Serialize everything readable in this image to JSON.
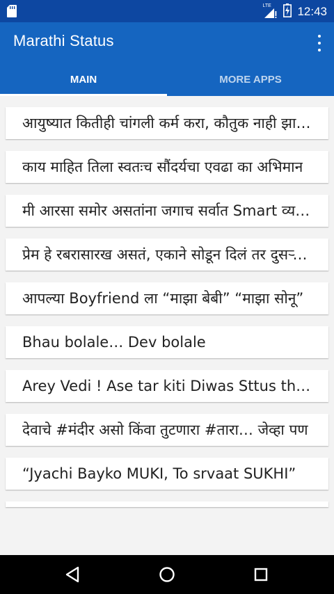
{
  "status_bar": {
    "time": "12:43",
    "network_label": "LTE",
    "icons": [
      "sd-card-icon",
      "signal-icon",
      "battery-icon"
    ]
  },
  "app_bar": {
    "title": "Marathi Status",
    "menu_icon": "overflow-menu-icon"
  },
  "tabs": [
    {
      "label": "MAIN",
      "active": true
    },
    {
      "label": "MORE APPS",
      "active": false
    }
  ],
  "list_items": [
    "आयुष्यात कितीही चांगली कर्म करा, कौतुक नाही झालं तरी चालेल",
    "काय माहित तिला स्वतःच सौंदर्यचा एवढा का अभिमान",
    "मी आरसा समोर असतांना जगाच सर्वात Smart व्यक्ती दिसते",
    "प्रेम हे रबरासारख असतं, एकाने सोडून दिलं तर दुसऱ्याला लागतं",
    "आपल्या Boyfriend ला “माझा बेबी” “माझा सोनू”",
    "Bhau bolale… Dev bolale",
    "Arey Vedi ! Ase tar kiti Diwas Sttus thevnar",
    "देवाचे #मंदीर असो किंवा तुटणारा #तारा… जेव्हा पण",
    "“Jyachi Bayko MUKI, To srvaat SUKHI”"
  ],
  "colors": {
    "status_bar": "#0D47A1",
    "app_bar": "#1565C0",
    "background": "#F3F3F3",
    "nav_bar": "#000000"
  },
  "nav_bar": {
    "icons": [
      "back-icon",
      "home-icon",
      "recents-icon"
    ]
  }
}
